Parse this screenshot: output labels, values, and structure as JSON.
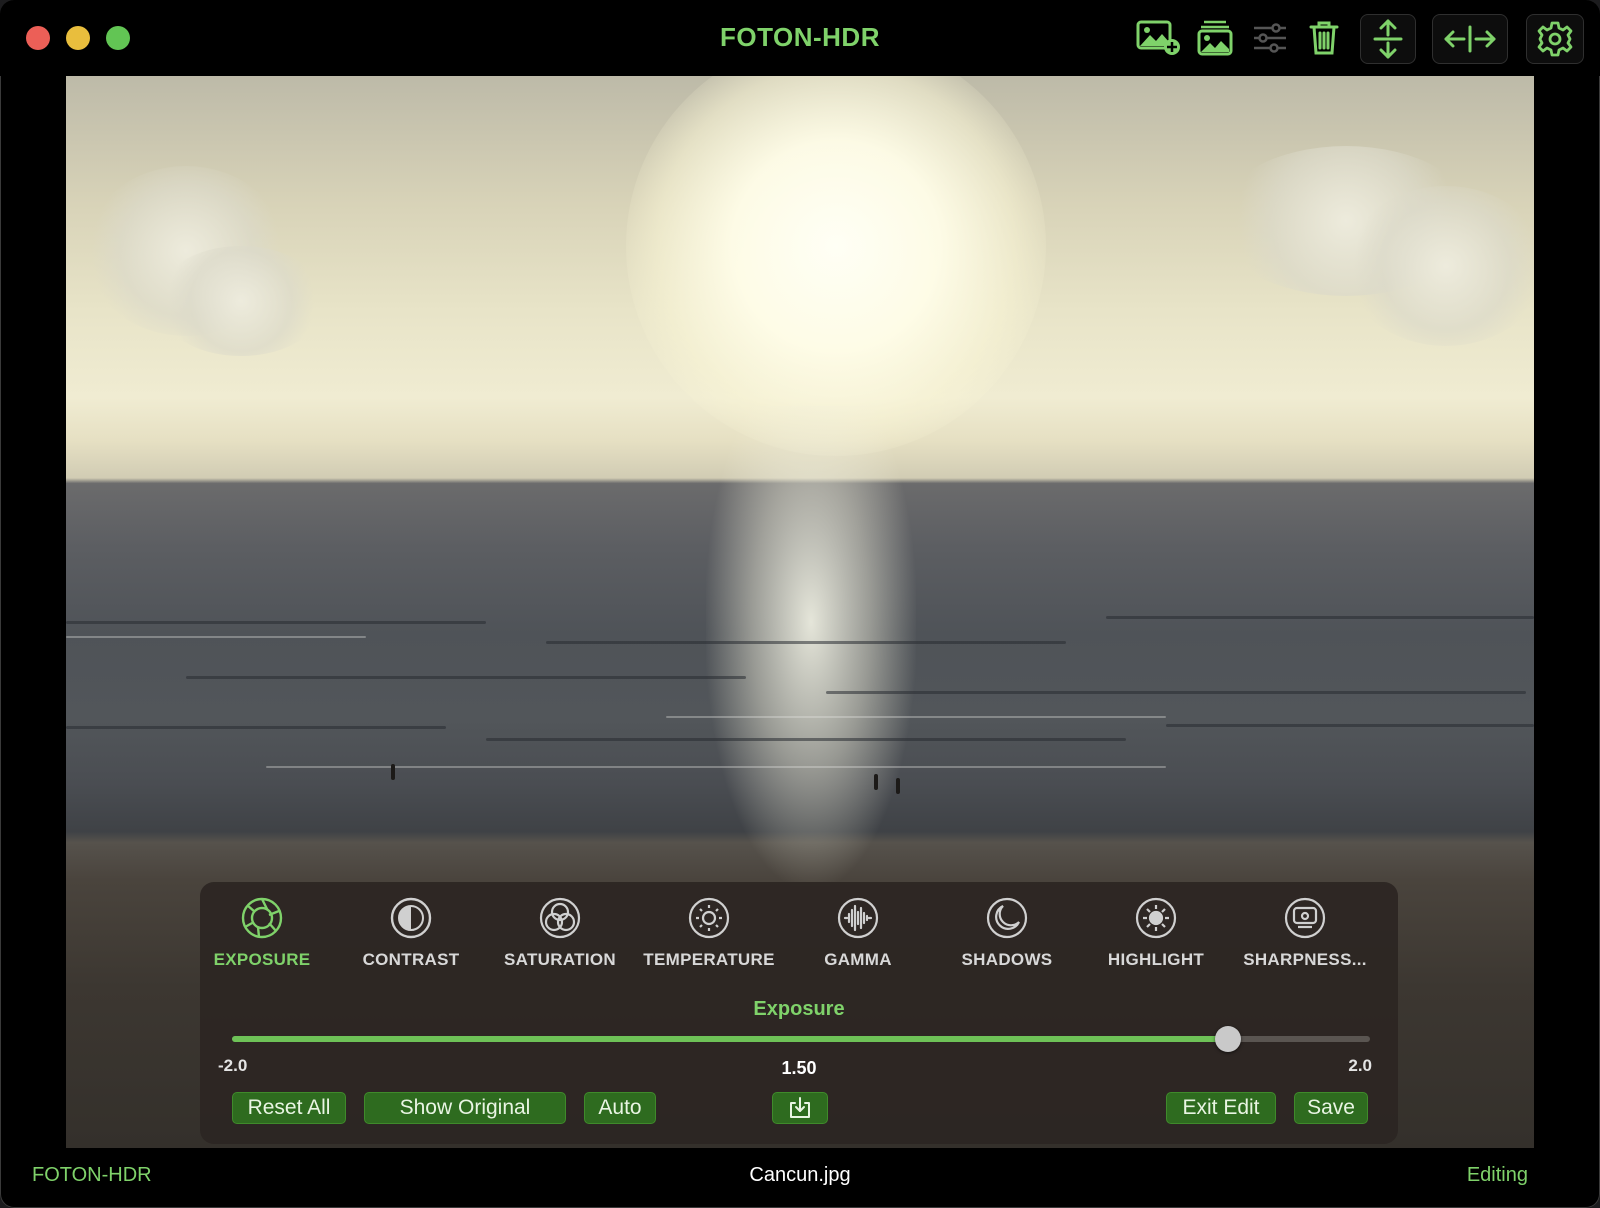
{
  "window": {
    "title": "FOTON-HDR"
  },
  "toolbar": {
    "icons": [
      "add-photo-icon",
      "photo-library-icon",
      "adjustments-icon",
      "trash-icon",
      "vertical-split-icon",
      "horizontal-split-icon",
      "gear-icon"
    ]
  },
  "photo": {
    "filename": "Cancun.jpg"
  },
  "tools": [
    {
      "label": "EXPOSURE",
      "icon": "aperture-icon",
      "active": true
    },
    {
      "label": "CONTRAST",
      "icon": "contrast-icon",
      "active": false
    },
    {
      "label": "SATURATION",
      "icon": "saturation-icon",
      "active": false
    },
    {
      "label": "TEMPERATURE",
      "icon": "temperature-sun-icon",
      "active": false
    },
    {
      "label": "GAMMA",
      "icon": "waveform-icon",
      "active": false
    },
    {
      "label": "SHADOWS",
      "icon": "moon-icon",
      "active": false
    },
    {
      "label": "HIGHLIGHT",
      "icon": "bright-sun-icon",
      "active": false
    },
    {
      "label": "SHARPNESS...",
      "icon": "sharpness-icon",
      "active": false
    }
  ],
  "slider": {
    "title": "Exposure",
    "min_label": "-2.0",
    "max_label": "2.0",
    "value_label": "1.50",
    "min": -2.0,
    "max": 2.0,
    "value": 1.5
  },
  "buttons": {
    "reset_all": "Reset All",
    "show_original": "Show Original",
    "auto": "Auto",
    "exit_edit": "Exit Edit",
    "save": "Save"
  },
  "status": {
    "left": "FOTON-HDR",
    "center": "Cancun.jpg",
    "right": "Editing"
  },
  "colors": {
    "accent": "#7fd26a",
    "button": "#2e6b1f",
    "slider_fill": "#6ec257"
  }
}
